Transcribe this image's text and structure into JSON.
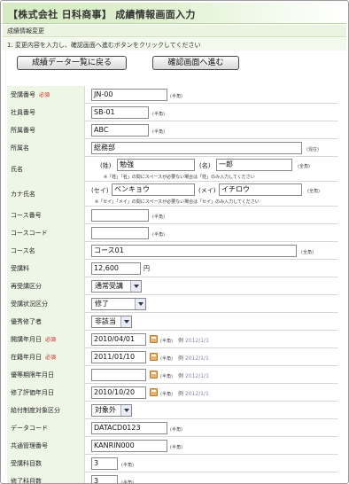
{
  "header": {
    "title": "【株式会社 日科商事】 成績情報画面入力",
    "subtitle": "成績情報変更",
    "instruction": "1. 変更内容を入力し、確認画面へ進むボタンをクリックしてください"
  },
  "buttons": {
    "back_label": "成績データ一覧に戻る",
    "next_label": "確認画面へ進む"
  },
  "common": {
    "required": "必須",
    "half": "(半角)",
    "full": "(全角)",
    "mixed": "(混在)",
    "example_prefix": "例",
    "yen": "円"
  },
  "fields": {
    "jukou_bangou": {
      "label": "受講番号",
      "value": "JN-00"
    },
    "shain_bangou": {
      "label": "社員番号",
      "value": "SB-01"
    },
    "shozoku_bangou": {
      "label": "所属番号",
      "value": "ABC"
    },
    "shozoku_mei": {
      "label": "所属名",
      "value": "総務部"
    },
    "shimei": {
      "label": "氏名",
      "sei_label": "(姓)",
      "sei_value": "勉強",
      "mei_label": "(名)",
      "mei_value": "一郎",
      "note": "※「姓」「名」の間にスペースが必要ない場合は「姓」のみ入力してください"
    },
    "kana": {
      "label": "カナ氏名",
      "sei_label": "(セイ)",
      "sei_value": "ベンキョウ",
      "mei_label": "(メイ)",
      "mei_value": "イチロウ",
      "note": "※「セイ」「メイ」の間にスペースが必要ない場合は「セイ」のみ入力してください"
    },
    "course_bangou": {
      "label": "コース番号",
      "value": ""
    },
    "course_code": {
      "label": "コースコード",
      "value": ""
    },
    "course_mei": {
      "label": "コース名",
      "value": "コース01"
    },
    "jukouryou": {
      "label": "受講料",
      "value": "12,600"
    },
    "saijukou": {
      "label": "再受講区分",
      "value": "通常受講"
    },
    "jukou_joukyou": {
      "label": "受講状況区分",
      "value": "修了"
    },
    "yuutou": {
      "label": "優秀修了者",
      "value": "非該当"
    },
    "kaikou": {
      "label": "開講年月日",
      "value": "2010/04/01",
      "example": "2012/1/1"
    },
    "zaiseki": {
      "label": "在籍年月日",
      "value": "2011/01/10",
      "example": "2012/1/1"
    },
    "yuutou_kigen": {
      "label": "優等期限年月日",
      "value": "",
      "example": "2012/1/1"
    },
    "shuuryou_gakusei": {
      "label": "修了評価年月日",
      "value": "2010/10/20",
      "example": "2012/1/1"
    },
    "kyuufu": {
      "label": "給付制度対象区分",
      "value": "対象外"
    },
    "data_code": {
      "label": "データコード",
      "value": "DATACD0123"
    },
    "kyoutsuu_kanri": {
      "label": "共通管理番号",
      "value": "KANRIN000"
    },
    "jukou_kamoku": {
      "label": "受講科目数",
      "value": "3"
    },
    "shuuryou_kamoku": {
      "label": "修了科目数",
      "value": "3"
    }
  }
}
